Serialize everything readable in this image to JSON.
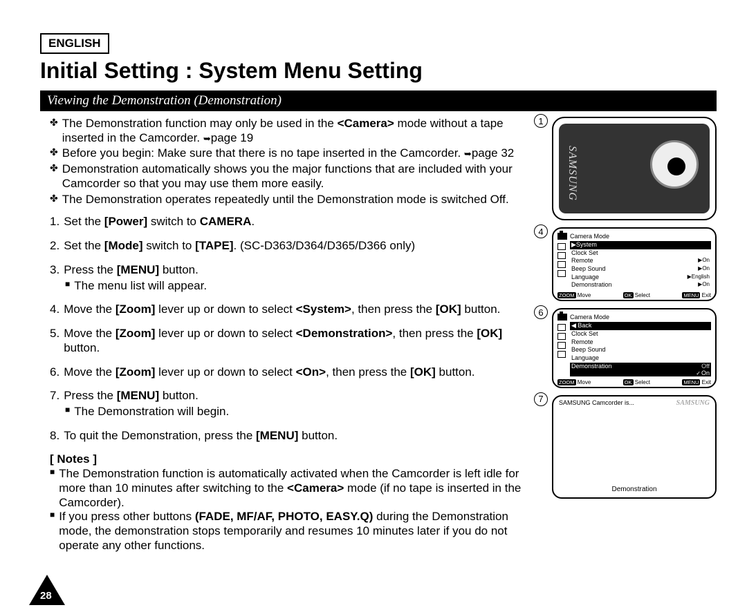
{
  "language": "ENGLISH",
  "title": "Initial Setting : System Menu Setting",
  "section_heading": "Viewing the Demonstration (Demonstration)",
  "intro": {
    "b1a": "The Demonstration function may only be used in the ",
    "b1b": " mode without a tape inserted in the Camcorder. ",
    "b1_mode": "<Camera>",
    "b1_ref": "page 19",
    "b2a": "Before you begin: Make sure that there is no tape inserted in the Camcorder. ",
    "b2_ref": "page 32",
    "b3": "Demonstration automatically shows you the major functions that are included with your Camcorder so that you may use them more easily.",
    "b4": "The Demonstration operates repeatedly until the Demonstration mode is switched Off."
  },
  "steps": {
    "s1a": "Set the ",
    "s1b": " switch to ",
    "s1_p": "[Power]",
    "s1_c": "CAMERA",
    "s1_end": ".",
    "s2a": "Set the ",
    "s2b": " switch to ",
    "s2_p": "[Mode]",
    "s2_c": "[TAPE]",
    "s2_end": ". (SC-D363/D364/D365/D366 only)",
    "s3a": "Press the ",
    "s3b": " button.",
    "s3_p": "[MENU]",
    "s3_sub": "The menu list will appear.",
    "s4a": "Move the ",
    "s4b": " lever up or down to select ",
    "s4c": ", then press the ",
    "s4d": " button.",
    "s4_zoom": "[Zoom]",
    "s4_sys": "<System>",
    "s4_ok": "[OK]",
    "s5a": "Move the ",
    "s5b": " lever up or down to select ",
    "s5c": ", then press the ",
    "s5d": " button.",
    "s5_zoom": "[Zoom]",
    "s5_demo": "<Demonstration>",
    "s5_ok": "[OK]",
    "s6a": "Move the ",
    "s6b": " lever up or down to select ",
    "s6c": ", then press the ",
    "s6d": " button.",
    "s6_zoom": "[Zoom]",
    "s6_on": "<On>",
    "s6_ok": "[OK]",
    "s7a": "Press the ",
    "s7b": " button.",
    "s7_p": "[MENU]",
    "s7_sub": "The Demonstration will begin.",
    "s8a": "To quit the Demonstration, press the ",
    "s8b": " button.",
    "s8_p": "[MENU]"
  },
  "notes_head": "[ Notes ]",
  "notes": {
    "n1a": "The Demonstration function is automatically activated when the Camcorder is left idle for more than 10 minutes after switching to the ",
    "n1b": " mode (if no tape is inserted in the Camcorder).",
    "n1_mode": "<Camera>",
    "n2a": "If you press other buttons ",
    "n2b": " during the Demonstration mode, the demonstration stops temporarily and resumes 10 minutes later if you do not operate any other functions.",
    "n2_btns": "(FADE, MF/AF, PHOTO, EASY.Q)"
  },
  "page_number": "28",
  "figs": {
    "f1_num": "1",
    "f1_brand": "SAMSUNG",
    "f4_num": "4",
    "f6_num": "6",
    "f7_num": "7",
    "lcd4": {
      "mode": "Camera Mode",
      "sel": "▶System",
      "i1": "Clock Set",
      "i2": "Remote",
      "v2": "▶On",
      "i3": "Beep Sound",
      "v3": "▶On",
      "i4": "Language",
      "v4": "▶English",
      "i5": "Demonstration",
      "v5": "▶On",
      "zoom": "ZOOM",
      "move": "Move",
      "ok": "OK",
      "select": "Select",
      "menu": "MENU",
      "exit": "Exit"
    },
    "lcd6": {
      "mode": "Camera Mode",
      "back": "◀ Back",
      "i1": "Clock Set",
      "i2": "Remote",
      "i3": "Beep Sound",
      "i4": "Language",
      "sel": "Demonstration",
      "off": "Off",
      "on": "On",
      "zoom": "ZOOM",
      "move": "Move",
      "ok": "OK",
      "select": "Select",
      "menu": "MENU",
      "exit": "Exit"
    },
    "demo": {
      "text": "SAMSUNG Camcorder is...",
      "logo": "SAMSUNG",
      "label": "Demonstration"
    }
  }
}
